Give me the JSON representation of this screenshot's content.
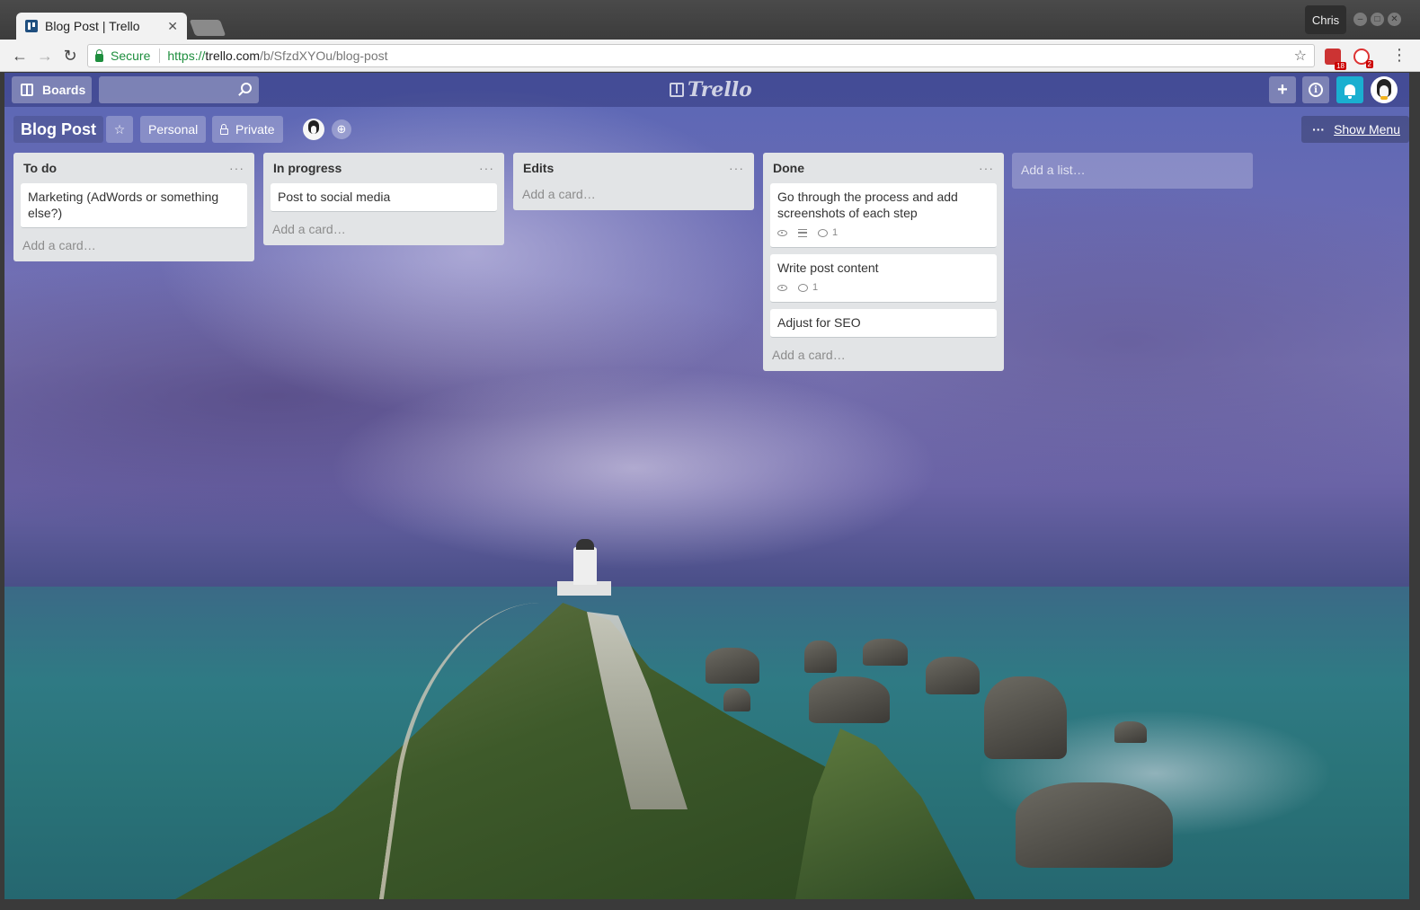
{
  "browser": {
    "tab_title": "Blog Post | Trello",
    "profile_name": "Chris",
    "secure_label": "Secure",
    "url_scheme": "https://",
    "url_host": "trello.com",
    "url_path": "/b/SfzdXYOu/blog-post",
    "extensions": [
      {
        "name": "calendar-extension-icon",
        "badge": "18"
      },
      {
        "name": "notification-extension-icon",
        "badge": "2"
      }
    ]
  },
  "header": {
    "boards_label": "Boards",
    "search_placeholder": "",
    "logo_text": "Trello",
    "create_icon": "+",
    "accent": "#1aafd0"
  },
  "board": {
    "title": "Blog Post",
    "team_label": "Personal",
    "visibility_label": "Private",
    "show_menu_label": "Show Menu",
    "add_list_label": "Add a list…"
  },
  "lists": [
    {
      "title": "To do",
      "menu": "···",
      "cards": [
        {
          "title": "Marketing (AdWords or something else?)"
        }
      ],
      "add_card": "Add a card…"
    },
    {
      "title": "In progress",
      "menu": "···",
      "cards": [
        {
          "title": "Post to social media"
        }
      ],
      "add_card": "Add a card…"
    },
    {
      "title": "Edits",
      "menu": "···",
      "cards": [],
      "add_card": "Add a card…"
    },
    {
      "title": "Done",
      "menu": "···",
      "cards": [
        {
          "title": "Go through the process and add screenshots of each step",
          "badges": {
            "watching": true,
            "description": true,
            "comments": "1"
          }
        },
        {
          "title": "Write post content",
          "badges": {
            "watching": true,
            "comments": "1"
          }
        },
        {
          "title": "Adjust for SEO"
        }
      ],
      "add_card": "Add a card…"
    }
  ]
}
